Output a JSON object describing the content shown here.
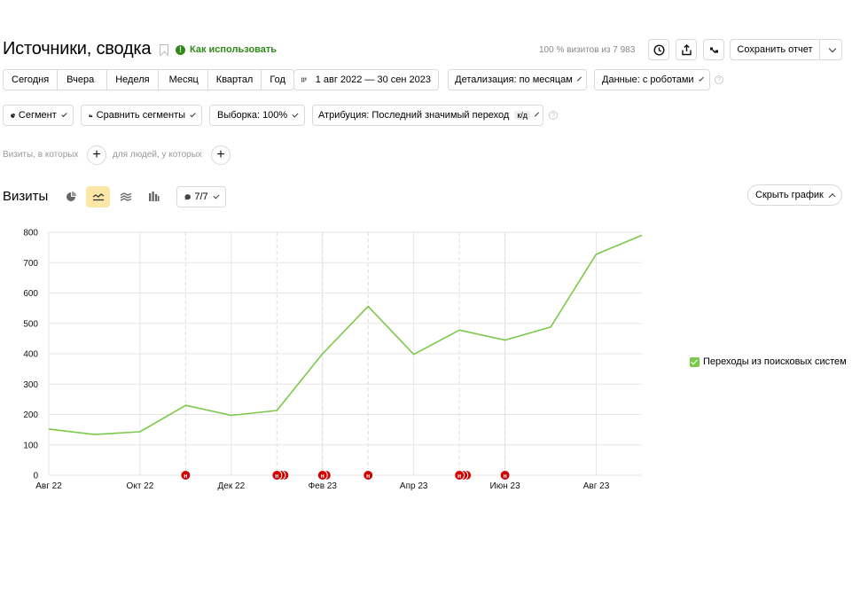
{
  "header": {
    "title": "Источники, сводка",
    "howto_label": "Как использовать",
    "howto_icon": "info-icon",
    "visits_info": "100 % визитов из 7 983",
    "save_report_label": "Сохранить отчет"
  },
  "period_buttons": [
    "Сегодня",
    "Вчера",
    "Неделя",
    "Месяц",
    "Квартал",
    "Год"
  ],
  "date_range": "1 авг 2022 — 30 сен 2023",
  "detail_label": "Детализация: по месяцам",
  "data_label": "Данные: с роботами",
  "segment_label": "Сегмент",
  "compare_label": "Сравнить сегменты",
  "sample_label": "Выборка: 100%",
  "attribution_label": "Атрибуция: Последний значимый переход",
  "attribution_badge": "к/д",
  "filters": {
    "visits_text": "Визиты, в которых",
    "people_text": "для людей, у которых"
  },
  "chart_section": {
    "title": "Визиты",
    "notes_label": "7/7",
    "hide_label": "Скрыть график"
  },
  "chart_data": {
    "type": "line",
    "x": [
      "Авг 22",
      "Сен 22",
      "Окт 22",
      "Ноя 22",
      "Дек 22",
      "Янв 23",
      "Фев 23",
      "Мар 23",
      "Апр 23",
      "Май 23",
      "Июн 23",
      "Июл 23",
      "Авг 23",
      "Сен 23"
    ],
    "x_tick_labels": [
      "Авг 22",
      "Окт 22",
      "Дек 22",
      "Фев 23",
      "Апр 23",
      "Июн 23",
      "Авг 23"
    ],
    "series": [
      {
        "name": "Переходы из поисковых систем",
        "color": "#7cc94a",
        "values": [
          152,
          134,
          143,
          230,
          197,
          213,
          400,
          556,
          398,
          478,
          445,
          488,
          728,
          790
        ]
      }
    ],
    "ylim": [
      0,
      800
    ],
    "yticks": [
      0,
      100,
      200,
      300,
      400,
      500,
      600,
      700,
      800
    ],
    "grid": true,
    "legend_position": "right",
    "note_marker_label": "н",
    "note_markers": [
      {
        "month": "Ноя 22",
        "count": 1
      },
      {
        "month": "Янв 23",
        "count": 3
      },
      {
        "month": "Фев 23",
        "count": 2
      },
      {
        "month": "Мар 23",
        "count": 1
      },
      {
        "month": "Май 23",
        "count": 3
      },
      {
        "month": "Июн 23",
        "count": 1
      }
    ]
  },
  "colors": {
    "accent_green": "#2d8a17",
    "series_green": "#7cc94a",
    "marker_red": "#d40000",
    "active_tool_bg": "#fde7a6"
  }
}
